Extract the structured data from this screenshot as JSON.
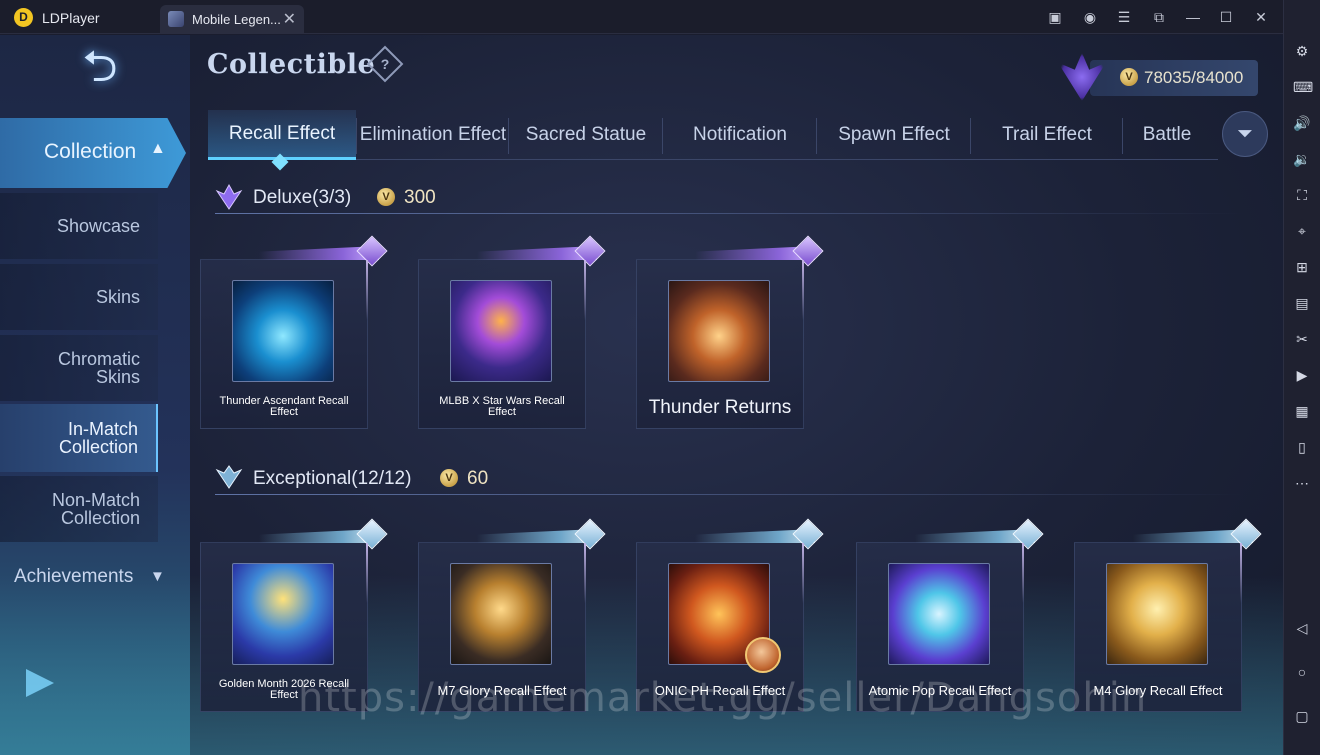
{
  "titlebar": {
    "app_name": "LDPlayer",
    "tab_label": "Mobile Legen...",
    "tab_close": "✕",
    "buttons": [
      "gift-icon",
      "account-icon",
      "menu-icon",
      "popout-icon",
      "minimize-icon",
      "maximize-icon",
      "close-icon",
      "collapse-icon"
    ]
  },
  "header": {
    "back_glyph": "⮌",
    "title": "Collectible",
    "help_glyph": "?",
    "currency_value": "78035/84000"
  },
  "tabs": [
    {
      "label": "Recall Effect",
      "active": true
    },
    {
      "label": "Elimination Effect",
      "active": false
    },
    {
      "label": "Sacred Statue",
      "active": false
    },
    {
      "label": "Notification",
      "active": false
    },
    {
      "label": "Spawn Effect",
      "active": false
    },
    {
      "label": "Trail Effect",
      "active": false
    },
    {
      "label": "Battle",
      "active": false
    }
  ],
  "sidebar": {
    "collection_label": "Collection",
    "items": [
      {
        "label": "Showcase",
        "active": false
      },
      {
        "label": "Skins",
        "active": false
      },
      {
        "label": "Chromatic Skins",
        "active": false
      },
      {
        "label": "In-Match Collection",
        "active": true
      },
      {
        "label": "Non-Match Collection",
        "active": false
      }
    ],
    "achievements_label": "Achievements"
  },
  "sections": {
    "deluxe": {
      "title": "Deluxe(3/3)",
      "price": "300",
      "items": [
        {
          "name": "Thunder Ascendant Recall Effect"
        },
        {
          "name": "MLBB X Star Wars Recall Effect"
        },
        {
          "name": "Thunder Returns"
        }
      ]
    },
    "exceptional": {
      "title": "Exceptional(12/12)",
      "price": "60",
      "items": [
        {
          "name": "Golden Month 2026 Recall Effect"
        },
        {
          "name": "M7 Glory Recall Effect"
        },
        {
          "name": "ONIC PH Recall Effect"
        },
        {
          "name": "Atomic Pop Recall Effect"
        },
        {
          "name": "M4 Glory Recall Effect"
        }
      ]
    }
  },
  "watermark": "https://gamemarket.gg/seller/Dangsohin",
  "rightbar_icons": [
    "settings-icon",
    "keyboard-icon",
    "volume-up-icon",
    "volume-down-icon",
    "screenshot-icon",
    "location-icon",
    "add-window-icon",
    "apk-icon",
    "scissors-icon",
    "record-icon",
    "operation-record-icon",
    "shake-icon",
    "more-icon",
    "back-nav-icon",
    "home-nav-icon",
    "recent-nav-icon"
  ],
  "colors": {
    "accent": "#5fd1ff",
    "deluxe": "#8a64d8",
    "exceptional": "#6fa6c9",
    "coin": "#c9a24a"
  }
}
